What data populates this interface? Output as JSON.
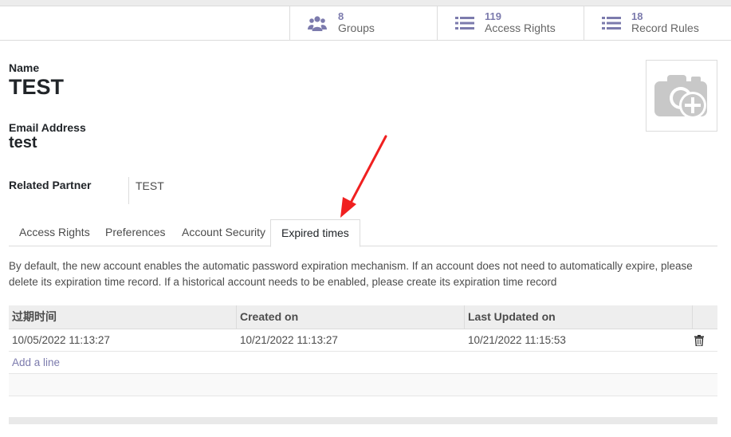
{
  "stats": [
    {
      "count": "8",
      "label": "Groups",
      "icon": "users-icon"
    },
    {
      "count": "119",
      "label": "Access Rights",
      "icon": "list-icon"
    },
    {
      "count": "18",
      "label": "Record Rules",
      "icon": "list-icon"
    }
  ],
  "form": {
    "name_label": "Name",
    "name_value": "TEST",
    "email_label": "Email Address",
    "email_value": "test",
    "partner_label": "Related Partner",
    "partner_value": "TEST"
  },
  "tabs": [
    {
      "label": "Access Rights",
      "active": false
    },
    {
      "label": "Preferences",
      "active": false
    },
    {
      "label": "Account Security",
      "active": false
    },
    {
      "label": "Expired times",
      "active": true
    }
  ],
  "description": "By default, the new account enables the automatic password expiration mechanism. If an account does not need to automatically expire, please delete its expiration time record. If a historical account needs to be enabled, please create its expiration time record",
  "grid": {
    "columns": [
      "过期时间",
      "Created on",
      "Last Updated on"
    ],
    "rows": [
      [
        "10/05/2022 11:13:27",
        "10/21/2022 11:13:27",
        "10/21/2022 11:15:53"
      ]
    ],
    "add_line": "Add a line"
  },
  "colors": {
    "accent": "#7c7bad",
    "annotation_arrow": "#f02020"
  }
}
